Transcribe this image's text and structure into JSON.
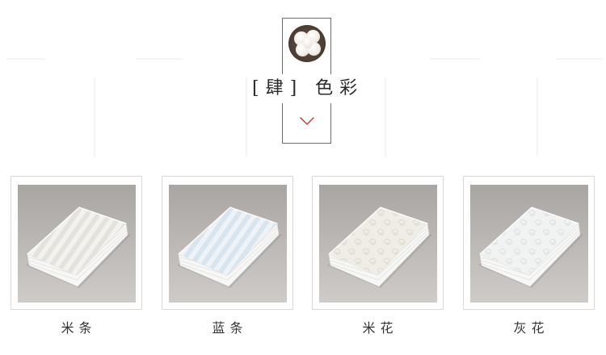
{
  "section": {
    "title": "[肆] 色彩",
    "icon": "cotton-icon"
  },
  "products": [
    {
      "label": "米条",
      "pattern": "stripe",
      "tone": "#f3f2ee",
      "stripe": "#e4e2dc"
    },
    {
      "label": "蓝条",
      "pattern": "stripe",
      "tone": "#eef3f8",
      "stripe": "#d8e4ee"
    },
    {
      "label": "米花",
      "pattern": "floral",
      "tone": "#efede6",
      "stripe": "#dcd8cc"
    },
    {
      "label": "灰花",
      "pattern": "floral",
      "tone": "#f1f2f2",
      "stripe": "#dcdfe0"
    }
  ],
  "colors": {
    "background": "#ffffff",
    "frame": "#6b6b6b",
    "card_border": "#d8d8d8",
    "chevron": "#c0392b",
    "photo_backdrop": "#b9b5b2"
  }
}
